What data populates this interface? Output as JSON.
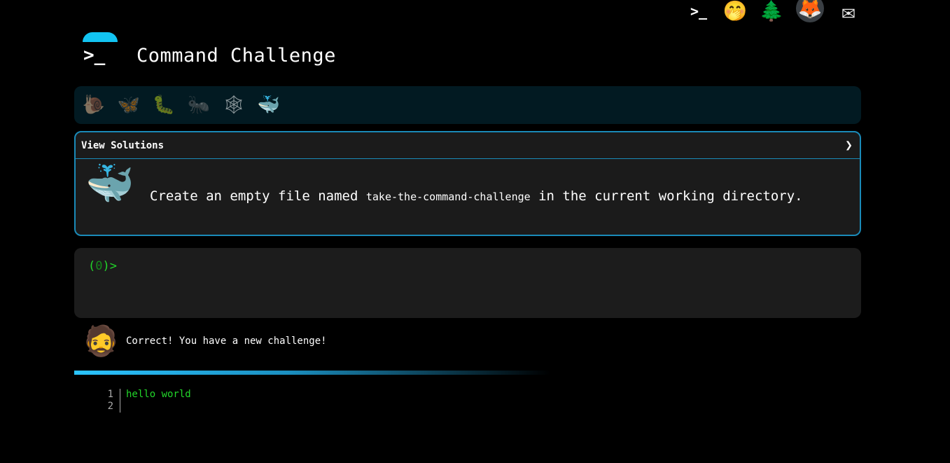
{
  "topbar": {
    "icons": [
      "terminal-prompt-icon",
      "face-with-hand-over-mouth-icon",
      "christmas-tree-icon",
      "gitlab-fox-icon",
      "envelope-icon"
    ],
    "terminal_glyph": ">_"
  },
  "header": {
    "title": "Command Challenge",
    "logo_glyph": ">_",
    "accent_color": "#12c4f2"
  },
  "levels": [
    {
      "name": "snail",
      "glyph": "🐌"
    },
    {
      "name": "butterfly",
      "glyph": "🦋"
    },
    {
      "name": "caterpillar",
      "glyph": "🐛"
    },
    {
      "name": "ant",
      "glyph": "🐜"
    },
    {
      "name": "spider-web",
      "glyph": "🕸"
    },
    {
      "name": "whale",
      "glyph": "🐳"
    }
  ],
  "challenge": {
    "view_solutions_label": "View Solutions",
    "chevron": "❯",
    "text_before": "Create an empty file named ",
    "filename": "take-the-command-challenge",
    "text_after": " in the current working directory.",
    "level_glyph": "🐳"
  },
  "terminal": {
    "prompt_open": "(",
    "prompt_code": "0",
    "prompt_close": ")>",
    "prompt_color": "#22d62a"
  },
  "message": {
    "avatar_glyph": "🧔",
    "text": "Correct! You have a new challenge!"
  },
  "editor": {
    "lines": [
      {
        "num": "1",
        "text": "hello world"
      },
      {
        "num": "2",
        "text": ""
      }
    ]
  }
}
